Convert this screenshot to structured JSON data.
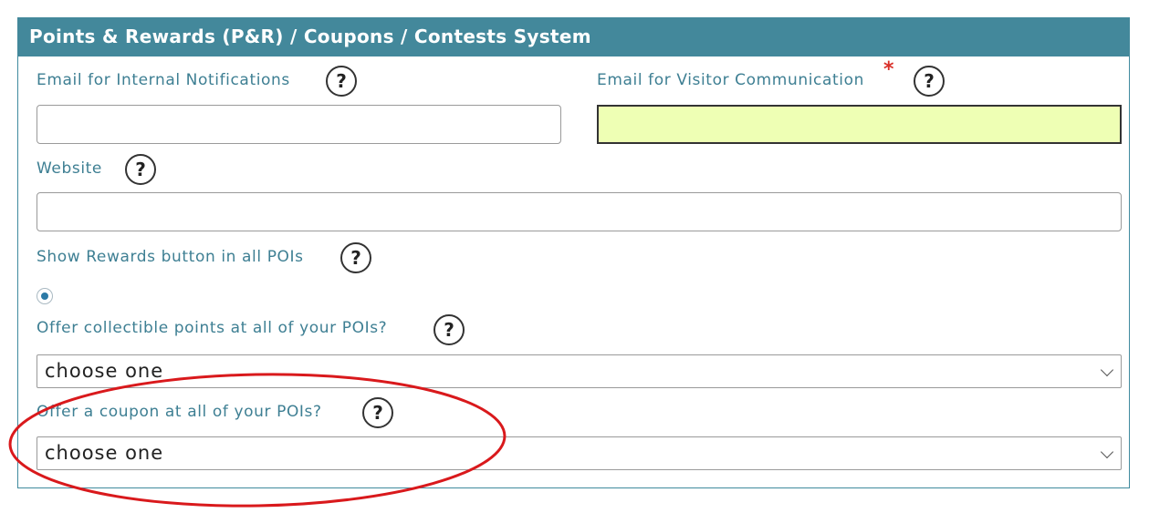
{
  "panel": {
    "title": "Points & Rewards (P&R) / Coupons / Contests System"
  },
  "fields": {
    "email_internal": {
      "label": "Email for Internal Notifications",
      "value": "",
      "placeholder": ""
    },
    "email_visitor": {
      "label": "Email for Visitor Communication",
      "required_mark": "*",
      "value": "",
      "placeholder": ""
    },
    "website": {
      "label": "Website",
      "value": "",
      "placeholder": ""
    },
    "show_rewards": {
      "label": "Show Rewards button in all POIs",
      "selected": true
    },
    "collectible_points": {
      "label": "Offer collectible points at all of your POIs?",
      "value": "choose one"
    },
    "coupon": {
      "label": "Offer a coupon at all of your POIs?",
      "value": "choose one"
    }
  },
  "help_glyph": "?",
  "colors": {
    "header_bg": "#43889b",
    "label": "#3e7f93",
    "highlight_field": "#eeffb4",
    "required": "#d9302a",
    "annotation": "#d9191c"
  },
  "icons": [
    "help-icon",
    "chevron-down-icon",
    "radio-selected-icon"
  ]
}
